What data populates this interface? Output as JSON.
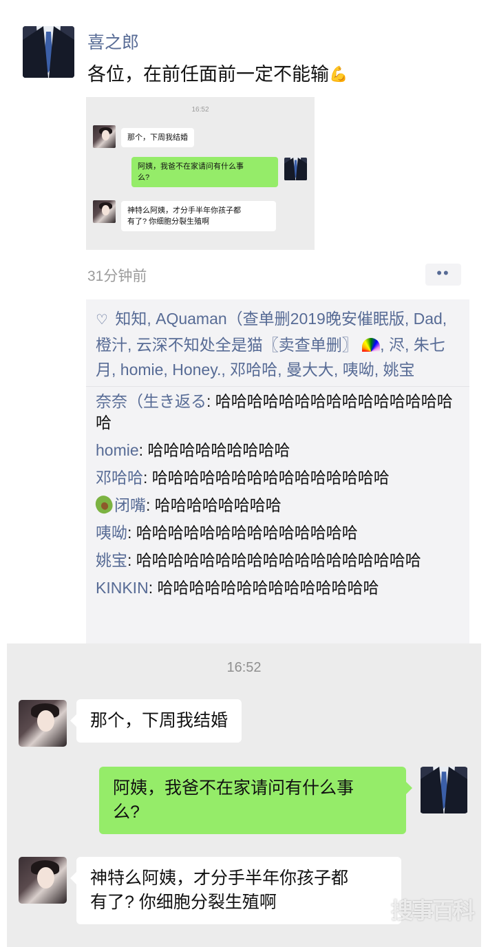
{
  "post": {
    "author": "喜之郎",
    "text": "各位，在前任面前一定不能输",
    "time": "31分钟前",
    "more_dots": "••"
  },
  "mini_chat": {
    "time": "16:52",
    "messages": [
      {
        "side": "left",
        "text": "那个，下周我结婚"
      },
      {
        "side": "right",
        "text_l1": "阿姨，我爸不在家请问有什么事",
        "text_l2": "么?"
      },
      {
        "side": "left",
        "text_l1": "神特么阿姨，才分手半年你孩子都",
        "text_l2": "有了? 你细胞分裂生殖啊"
      }
    ]
  },
  "likes": {
    "names_part1": "知知, AQuaman（查单删2019晚安催眠版, Dad, 橙汁, 云深不知处全是猫〖卖查单删〗",
    "names_part2": ", 浕, 朱七月, homie, Honey., 邓哈哈, 曼大大, 咦呦, 姚宝"
  },
  "comments": [
    {
      "name": "奈奈（生き返る",
      "text": ": 哈哈哈哈哈哈哈哈哈哈哈哈哈哈哈哈"
    },
    {
      "name": "homie",
      "text": ": 哈哈哈哈哈哈哈哈哈"
    },
    {
      "name": "邓哈哈",
      "text": ": 哈哈哈哈哈哈哈哈哈哈哈哈哈哈哈"
    },
    {
      "name": "闭嘴",
      "text": ": 哈哈哈哈哈哈哈哈"
    },
    {
      "name": "咦呦",
      "text": ": 哈哈哈哈哈哈哈哈哈哈哈哈哈哈"
    },
    {
      "name": "姚宝",
      "text": ": 哈哈哈哈哈哈哈哈哈哈哈哈哈哈哈哈哈哈"
    },
    {
      "name": "KINKIN",
      "text": ": 哈哈哈哈哈哈哈哈哈哈哈哈哈哈"
    }
  ],
  "chat": {
    "time": "16:52",
    "msg1": "那个，下周我结婚",
    "msg2_l1": "阿姨，我爸不在家请问有什么事",
    "msg2_l2": "么?",
    "msg3_l1": "神特么阿姨，才分手半年你孩子都",
    "msg3_l2": "有了? 你细胞分裂生殖啊"
  },
  "watermark": "搜事百科",
  "icons": {
    "heart": "heart-icon",
    "flex": "flexed-biceps-emoji",
    "rainbow": "rainbow-emoji",
    "avocado": "avocado-emoji"
  },
  "colors": {
    "link_blue": "#576b95",
    "bubble_green": "#95ec69",
    "chat_bg": "#ececec",
    "comments_bg": "#f3f3f5"
  }
}
